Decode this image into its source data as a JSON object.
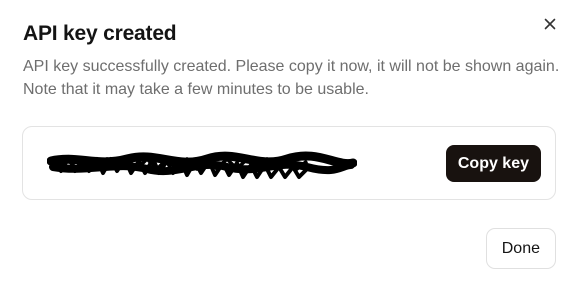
{
  "dialog": {
    "title": "API key created",
    "description": "API key successfully created. Please copy it now, it will not be shown again. Note that it may take a few minutes to be usable.",
    "close_icon": "close-icon",
    "key_display": {
      "redacted": true,
      "redaction_style": "black-scribble"
    },
    "copy_button_label": "Copy key",
    "done_button_label": "Done"
  },
  "colors": {
    "background": "#ffffff",
    "title": "#141414",
    "description": "#6e6e6e",
    "primary_button_bg": "#18120f",
    "primary_button_text": "#ffffff",
    "border": "#e3e3e3"
  }
}
